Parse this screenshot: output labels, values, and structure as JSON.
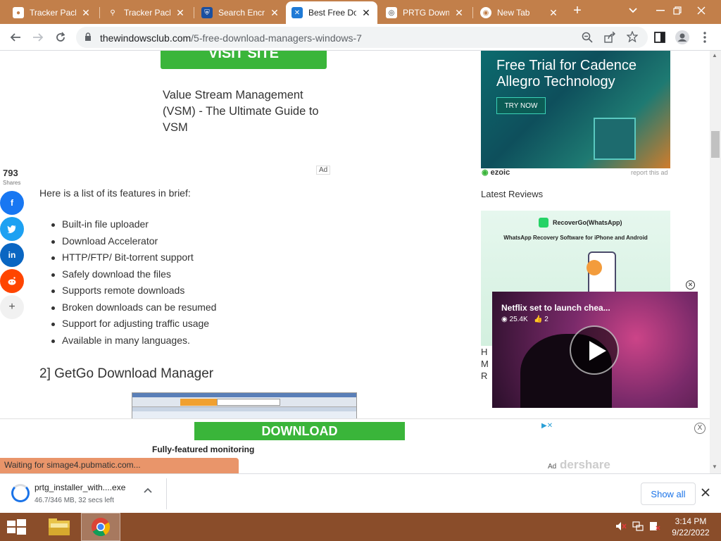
{
  "colors": {
    "tabstrip": "#c27f4a",
    "taskbar": "#8a4d2a",
    "accent_green": "#3ab53a",
    "link_blue": "#1a73e8",
    "status_orange": "#e9956a"
  },
  "tabs": [
    {
      "label": "Tracker Pack",
      "icon": "cpanel-icon",
      "close": "✕"
    },
    {
      "label": "Tracker Pack",
      "icon": "search-icon",
      "close": "✕"
    },
    {
      "label": "Search Encry",
      "icon": "shield-icon",
      "close": "✕"
    },
    {
      "label": "Best Free Do",
      "icon": "windowsclub-icon",
      "close": "✕"
    },
    {
      "label": "PRTG Downl",
      "icon": "prtg-icon",
      "close": "✕"
    },
    {
      "label": "New Tab",
      "icon": "chrome-icon",
      "close": "✕"
    }
  ],
  "newtab_symbol": "+",
  "toolbar": {
    "url_host": "thewindowsclub.com",
    "url_path": "/5-free-download-managers-windows-7"
  },
  "article": {
    "visit_site": "VISIT SITE",
    "vsm_text": "Value Stream Management (VSM) - The Ultimate Guide to VSM",
    "shares_count": "793",
    "shares_label": "Shares",
    "ad_label": "Ad",
    "intro": "Here is a list of its features in brief:",
    "features": [
      "Built-in file uploader",
      "Download Accelerator",
      "HTTP/FTP/ Bit-torrent support",
      "Safely download the files",
      "Supports remote downloads",
      "Broken downloads can be resumed",
      "Support for adjusting traffic usage",
      "Available in many languages."
    ],
    "section_heading": "2] GetGo Download Manager"
  },
  "social": {
    "more": "+"
  },
  "sidebar": {
    "ad_title": "Free Trial for Cadence Allegro Technology",
    "ad_button": "TRY NOW",
    "ezoic": "ezoic",
    "report": "report this ad",
    "latest_reviews": "Latest Reviews",
    "review_brand": "RecoverGo(WhatsApp)",
    "review_sub": "WhatsApp Recovery Software for iPhone and Android",
    "review_partial": [
      "H",
      "M",
      "R"
    ]
  },
  "video": {
    "title": "Netflix set to launch chea...",
    "views": "25.4K",
    "likes": "2",
    "close": "✕"
  },
  "bottom_ad": {
    "download": "DOWNLOAD",
    "fully": "Fully-featured monitoring",
    "ad_label": "Ad",
    "brand_partial": "dershare",
    "close": "X"
  },
  "status_text": "Waiting for simage4.pubmatic.com...",
  "download": {
    "filename": "prtg_installer_with....exe",
    "meta": "46.7/346 MB, 32 secs left",
    "progress": 0.135,
    "show_all": "Show all"
  },
  "taskbar": {
    "time": "3:14 PM",
    "date": "9/22/2022"
  }
}
